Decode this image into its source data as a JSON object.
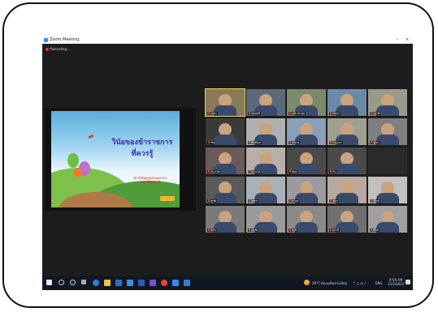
{
  "window": {
    "title": "Zoom Meeting",
    "minimize": "–",
    "close": "×"
  },
  "recording": {
    "label": "Recording..."
  },
  "slide": {
    "title_line1": "วินัยของข้าราชการ",
    "title_line2": "ที่ควรรู้",
    "subtitle_line1": "ฝ่ายวินัยครูและบุคลากร",
    "subtitle_line2": "สพป.ปทุมธานี",
    "colors": {
      "title": "#3b2ea8",
      "sky": "#5aaedc"
    }
  },
  "participants": [
    {
      "name": "อนุชา",
      "color": "#8a7a5a",
      "active": true
    },
    {
      "name": "ครูสมศรี",
      "color": "#5a6a7a"
    },
    {
      "name": "มนัส ประทุม",
      "color": "#7a8a6a"
    },
    {
      "name": "จันทรา",
      "color": "#6a8aa8"
    },
    {
      "name": "ธนาธิป",
      "color": "#9a9a8a"
    },
    {
      "name": "วิชัย",
      "color": "#3a3a3a"
    },
    {
      "name": "พิมพ์ชนก",
      "color": "#b0b0b0"
    },
    {
      "name": "สมชาย",
      "color": "#8aa0b8"
    },
    {
      "name": "กาญจนา",
      "color": "#a0a090"
    },
    {
      "name": "ชุติมา",
      "color": "#808080"
    },
    {
      "name": "ประภาพร",
      "color": "#6a5a5a"
    },
    {
      "name": "วราภรณ์",
      "color": "#b8b0a8"
    },
    {
      "name": "นิตยา",
      "color": "#4a4a4a"
    },
    {
      "name": "ธีระ",
      "color": "#4a4a4a"
    },
    {
      "name": "",
      "color": "#2a2a2a"
    },
    {
      "name": "สุรชัย",
      "color": "#5a5a5a"
    },
    {
      "name": "สุพัตรา",
      "color": "#a8b0b8"
    },
    {
      "name": "มานพ",
      "color": "#9a9aa0"
    },
    {
      "name": "รัตนา",
      "color": "#b8a8a0"
    },
    {
      "name": "เกียรติ",
      "color": "#c0c0c0"
    },
    {
      "name": "สมใจ",
      "color": "#7a7a7a"
    },
    {
      "name": "บุญชัย",
      "color": "#9a9a9a"
    },
    {
      "name": "อรุณี",
      "color": "#8a8a8a"
    },
    {
      "name": "ปราณี",
      "color": "#707070"
    },
    {
      "name": "ศิริพร",
      "color": "#a0a0a0"
    }
  ],
  "taskbar": {
    "weather": "29°C มีเมฆเป็นส่วนใหญ่",
    "lang": "ENG",
    "time": "9:59 AM",
    "date": "1/22/2022"
  }
}
